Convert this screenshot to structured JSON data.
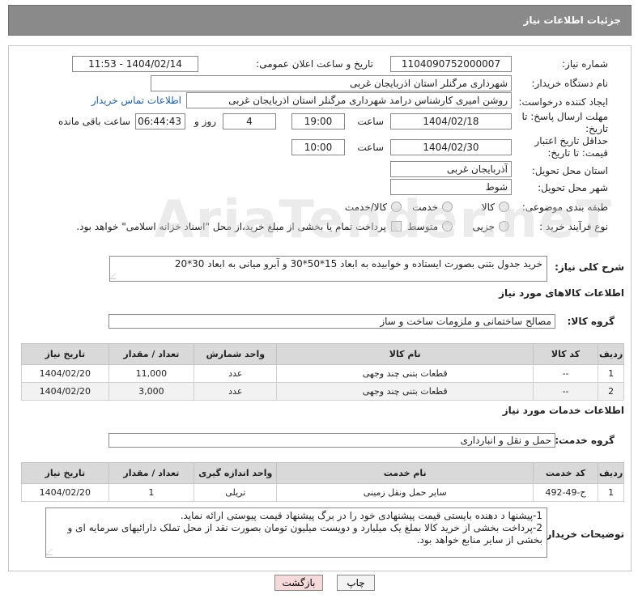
{
  "header": {
    "title": "جزئیات اطلاعات نیاز"
  },
  "form": {
    "need_number_label": "شماره نیاز:",
    "need_number": "1104090752000007",
    "announce_label": "تاریخ و ساعت اعلان عمومی:",
    "announce_value": "1404/02/14 - 11:53",
    "buyer_org_label": "نام دستگاه خریدار:",
    "buyer_org": "شهرداری مرگنلر استان اذربایجان غربی",
    "creator_label": "ایجاد کننده درخواست:",
    "creator": "روشن امیری کارشناس درامد شهرداری مرگنلر استان اذربایجان غربی",
    "contact_link": "اطلاعات تماس خریدار",
    "deadline_label": "مهلت ارسال پاسخ: تا تاریخ:",
    "deadline_date": "1404/02/18",
    "time_label": "ساعت",
    "deadline_time": "19:00",
    "days": "4",
    "days_label": "روز و",
    "remaining_time": "06:44:43",
    "remaining_label": "ساعت باقی مانده",
    "validity_label": "حداقل تاریخ اعتبار قیمت: تا تاریخ:",
    "validity_date": "1404/02/30",
    "validity_time_label": "ساعت",
    "validity_time": "10:00",
    "province_label": "استان محل تحویل:",
    "province": "آذربایجان غربی",
    "city_label": "شهر محل تحویل:",
    "city": "شوط",
    "category_label": "طبقه بندی موضوعی:",
    "category_options": [
      "کالا",
      "خدمت",
      "کالا/خدمت"
    ],
    "process_label": "نوع فرآیند خرید :",
    "process_options": [
      "جزیی",
      "متوسط"
    ],
    "payment_note": "پرداخت تمام یا بخشی از مبلغ خرید،از محل \"اسناد خزانه اسلامی\" خواهد بود."
  },
  "description": {
    "label": "شرح کلی نیاز:",
    "text": "خرید جدول بتنی بصورت ایستاده و خوابیده به ابعاد 15*50*30 و آبرو میانی به ابعاد  30*20"
  },
  "goods": {
    "section_title": "اطلاعات کالاهای مورد نیاز",
    "group_label": "گروه کالا:",
    "group_value": "مصالح ساختمانی و ملزومات ساخت و ساز",
    "columns": [
      "ردیف",
      "کد کالا",
      "نام کالا",
      "واحد شمارش",
      "تعداد / مقدار",
      "تاریخ نیاز"
    ],
    "rows": [
      [
        "1",
        "--",
        "قطعات بتنی چند وجهی",
        "عدد",
        "11,000",
        "1404/02/20"
      ],
      [
        "2",
        "--",
        "قطعات بتنی چند وجهی",
        "عدد",
        "3,000",
        "1404/02/20"
      ]
    ]
  },
  "services": {
    "section_title": "اطلاعات خدمات مورد نیاز",
    "group_label": "گروه خدمت:",
    "group_value": "حمل و نقل و انبارداری",
    "columns": [
      "ردیف",
      "کد خدمت",
      "نام خدمت",
      "واحد اندازه گیری",
      "تعداد / مقدار",
      "تاریخ نیاز"
    ],
    "rows": [
      [
        "1",
        "ح-49-492",
        "سایر حمل ونقل زمینی",
        "تریلی",
        "1",
        "1404/02/20"
      ]
    ]
  },
  "buyer_notes": {
    "label": "توضیحات خریدار:",
    "line1": "1-پیشنها د دهنده بایستی  قیمت پیشنهادی خود را در برگ پیشنهاد قیمت پیوستی ارائه نماید.",
    "line2": "2-پرداخت بخشی از خرید کالا بملغ یک میلیارد و دویست میلیون تومان بصورت نقد از محل تملک دارائیهای سرمایه ای و بخشی از سایر منابع خواهد بود."
  },
  "buttons": {
    "print": "چاپ",
    "back": "بازگشت"
  },
  "colors": {
    "header_bg": "#8a8a8a",
    "link": "#1a5fb4",
    "back_button_bg": "#f6d9d9",
    "print_button_bg": "#f3f3f3"
  },
  "watermark": "AriaTender.neT"
}
